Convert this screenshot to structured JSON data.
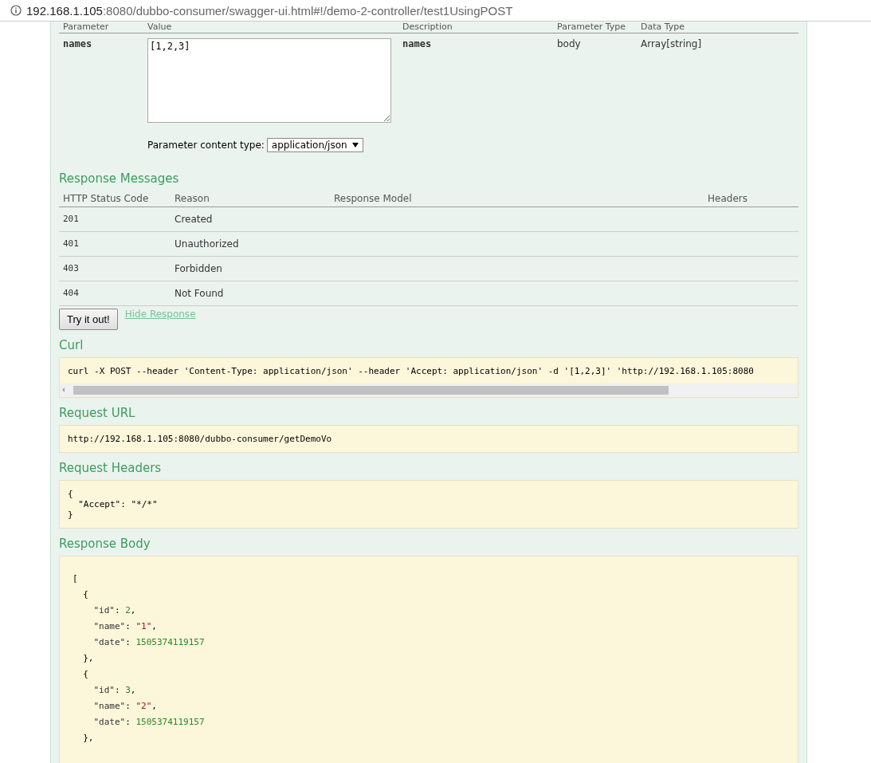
{
  "address_bar": {
    "host": "192.168.1.105",
    "rest": ":8080/dubbo-consumer/swagger-ui.html#!/demo-2-controller/test1UsingPOST"
  },
  "parameters": {
    "columns": [
      "Parameter",
      "Value",
      "Description",
      "Parameter Type",
      "Data Type"
    ],
    "rows": [
      {
        "name": "names",
        "value": "[1,2,3]",
        "description": "names",
        "parameter_type": "body",
        "data_type": "Array[string]"
      }
    ],
    "content_type_label": "Parameter content type:",
    "content_type": "application/json"
  },
  "response_messages": {
    "title": "Response Messages",
    "columns": [
      "HTTP Status Code",
      "Reason",
      "Response Model",
      "Headers"
    ],
    "rows": [
      {
        "code": "201",
        "reason": "Created"
      },
      {
        "code": "401",
        "reason": "Unauthorized"
      },
      {
        "code": "403",
        "reason": "Forbidden"
      },
      {
        "code": "404",
        "reason": "Not Found"
      }
    ]
  },
  "try_button": "Try it out!",
  "hide_link": "Hide Response",
  "curl": {
    "title": "Curl",
    "text": "curl -X POST --header 'Content-Type: application/json' --header 'Accept: application/json' -d '[1,2,3]' 'http://192.168.1.105:8080"
  },
  "request_url": {
    "title": "Request URL",
    "text": "http://192.168.1.105:8080/dubbo-consumer/getDemoVo"
  },
  "request_headers": {
    "title": "Request Headers",
    "lines": [
      "{",
      "  \"Accept\": \"*/*\"",
      "}"
    ]
  },
  "response_body": {
    "title": "Response Body",
    "lines": [
      [
        {
          "kind": "punct",
          "text": "["
        }
      ],
      [
        {
          "kind": "punct",
          "text": "  {"
        }
      ],
      [
        {
          "kind": "key",
          "text": "    \"id\""
        },
        {
          "kind": "punct",
          "text": ": "
        },
        {
          "kind": "number",
          "text": "2"
        },
        {
          "kind": "punct",
          "text": ","
        }
      ],
      [
        {
          "kind": "key",
          "text": "    \"name\""
        },
        {
          "kind": "punct",
          "text": ": "
        },
        {
          "kind": "string",
          "text": "\"1\""
        },
        {
          "kind": "punct",
          "text": ","
        }
      ],
      [
        {
          "kind": "key",
          "text": "    \"date\""
        },
        {
          "kind": "punct",
          "text": ": "
        },
        {
          "kind": "number",
          "text": "1505374119157"
        }
      ],
      [
        {
          "kind": "punct",
          "text": "  },"
        }
      ],
      [
        {
          "kind": "punct",
          "text": "  {"
        }
      ],
      [
        {
          "kind": "key",
          "text": "    \"id\""
        },
        {
          "kind": "punct",
          "text": ": "
        },
        {
          "kind": "number",
          "text": "3"
        },
        {
          "kind": "punct",
          "text": ","
        }
      ],
      [
        {
          "kind": "key",
          "text": "    \"name\""
        },
        {
          "kind": "punct",
          "text": ": "
        },
        {
          "kind": "string",
          "text": "\"2\""
        },
        {
          "kind": "punct",
          "text": ","
        }
      ],
      [
        {
          "kind": "key",
          "text": "    \"date\""
        },
        {
          "kind": "punct",
          "text": ": "
        },
        {
          "kind": "number",
          "text": "1505374119157"
        }
      ],
      [
        {
          "kind": "punct",
          "text": "  },"
        }
      ]
    ]
  }
}
